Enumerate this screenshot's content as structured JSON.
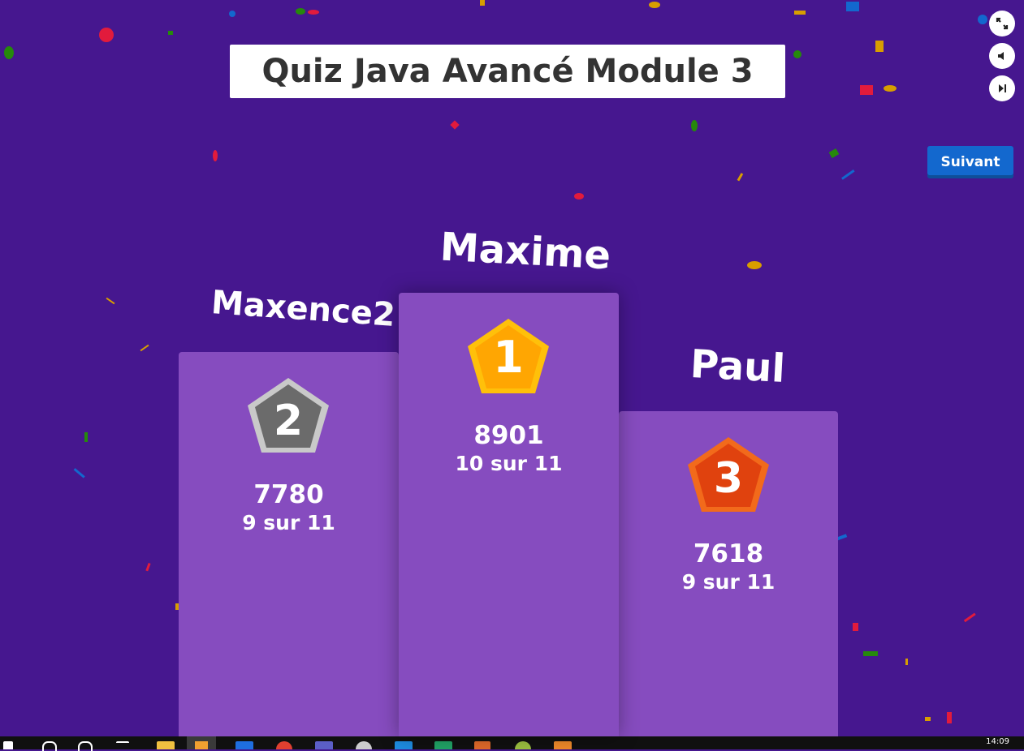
{
  "header": {
    "quiz_title": "Quiz Java Avancé Module 3"
  },
  "controls": {
    "next_label": "Suivant",
    "side_buttons": [
      {
        "name": "fullscreen-icon"
      },
      {
        "name": "volume-icon"
      },
      {
        "name": "skip-icon"
      }
    ]
  },
  "podium": {
    "first": {
      "rank": "1",
      "name": "Maxime",
      "score": "8901",
      "correct": "10 sur 11",
      "medal_color": "#ffa602"
    },
    "second": {
      "rank": "2",
      "name": "Maxence2",
      "score": "7780",
      "correct": "9 sur 11",
      "medal_color": "#6b6b6b"
    },
    "third": {
      "rank": "3",
      "name": "Paul",
      "score": "7618",
      "correct": "9 sur 11",
      "medal_color": "#e0420e"
    }
  },
  "taskbar": {
    "clock": "14:09"
  },
  "colors": {
    "background": "#46178f",
    "podium": "#864cbf",
    "accent_button": "#1368ce"
  }
}
